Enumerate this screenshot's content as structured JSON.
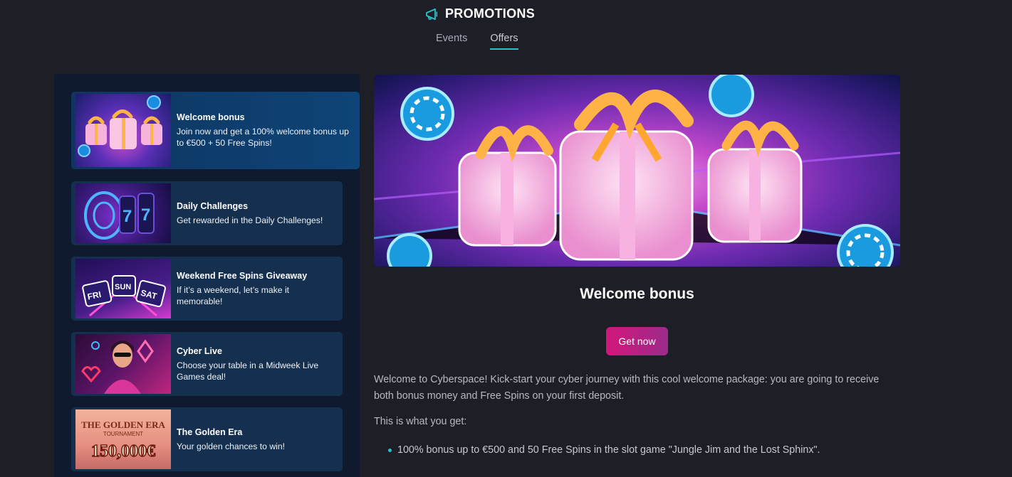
{
  "header": {
    "title": "PROMOTIONS",
    "icon": "megaphone-icon",
    "accent": "#29c2c8"
  },
  "tabs": [
    {
      "label": "Events",
      "active": false
    },
    {
      "label": "Offers",
      "active": true
    }
  ],
  "promotions": [
    {
      "title": "Welcome bonus",
      "description": "Join now and get a 100% welcome bonus up to €500 + 50 Free Spins!",
      "active": true
    },
    {
      "title": "Daily Challenges",
      "description": "Get rewarded in the Daily Challenges!",
      "active": false
    },
    {
      "title": "Weekend Free Spins Giveaway",
      "description": "If it’s a weekend, let’s make it memorable!",
      "active": false
    },
    {
      "title": "Cyber Live",
      "description": "Choose your table in a Midweek Live Games deal!",
      "active": false
    },
    {
      "title": "The Golden Era",
      "description": "Your golden chances to win!",
      "active": false
    }
  ],
  "thumb_text": {
    "weekend_days": [
      "FRI",
      "SUN",
      "SAT"
    ],
    "golden_line1": "THE GOLDEN ERA",
    "golden_line2": "TOURNAMENT",
    "golden_amount": "150,000€"
  },
  "main": {
    "title": "Welcome bonus",
    "button_label": "Get now",
    "paragraph1": "Welcome to Cyberspace! Kick-start your cyber journey with this cool welcome package: you are going to receive both bonus money and Free Spins on your first deposit.",
    "paragraph2": "This is what you get:",
    "bullets": [
      "100% bonus up to €500 and 50 Free Spins in the slot game \"Jungle Jim and the Lost Sphinx\"."
    ]
  }
}
